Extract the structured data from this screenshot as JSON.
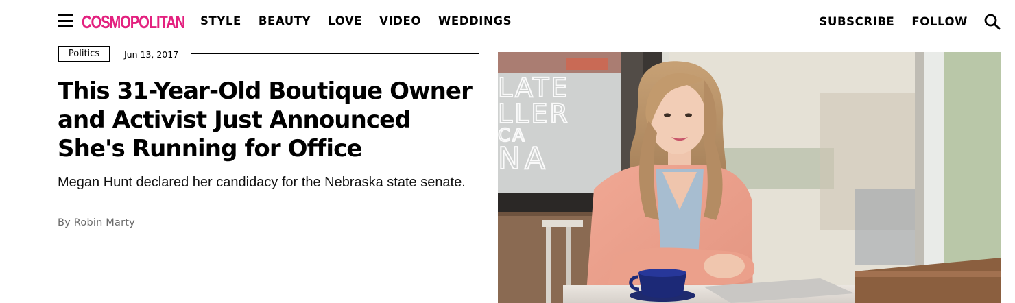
{
  "header": {
    "logo_text": "COSMOPOLITAN",
    "nav": {
      "style": "STYLE",
      "beauty": "BEAUTY",
      "love": "LOVE",
      "video": "VIDEO",
      "weddings": "WEDDINGS"
    },
    "right_nav": {
      "subscribe": "SUBSCRIBE",
      "follow": "FOLLOW"
    },
    "icons": {
      "menu": "hamburger-menu-icon",
      "search": "search-icon"
    }
  },
  "article": {
    "category": "Politics",
    "date": "Jun 13, 2017",
    "headline": "This 31-Year-Old Boutique Owner and Activist Just Announced She's Running for Office",
    "dek": "Megan Hunt declared her candidacy for the Nebraska state senate.",
    "byline_prefix": "By",
    "author": "Robin Marty"
  },
  "hero_image": {
    "window_sign_letters": [
      "LATE",
      "LLER",
      "CA",
      "NA"
    ]
  },
  "colors": {
    "brand_pink": "#e3217f",
    "text": "#000000",
    "byline_gray": "#6b6b6b"
  }
}
